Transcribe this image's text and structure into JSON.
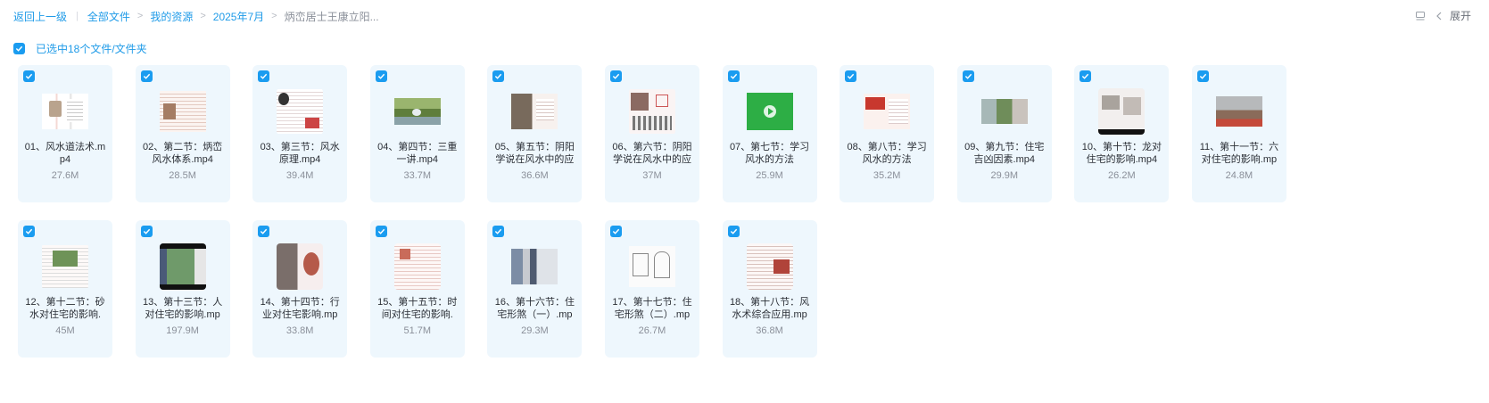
{
  "breadcrumb": {
    "back": "返回上一级",
    "items": [
      "全部文件",
      "我的资源",
      "2025年7月"
    ],
    "current": "炳峦居士王康立阳..."
  },
  "toolbar": {
    "expand_label": "展开"
  },
  "selection": {
    "label": "已选中18个文件/文件夹"
  },
  "files": [
    {
      "name": "01、风水道法术.mp4",
      "size": "27.6M",
      "thumb": "doc"
    },
    {
      "name": "02、第二节：炳峦风水体系.mp4",
      "size": "28.5M",
      "thumb": "doc2"
    },
    {
      "name": "03、第三节：风水原理.mp4",
      "size": "39.4M",
      "thumb": "doc3"
    },
    {
      "name": "04、第四节：三重一讲.mp4",
      "size": "33.7M",
      "thumb": "photo"
    },
    {
      "name": "05、第五节：阴阳学说在风水中的应",
      "size": "36.6M",
      "thumb": "photo2"
    },
    {
      "name": "06、第六节：阴阳学说在风水中的应",
      "size": "37M",
      "thumb": "doc4"
    },
    {
      "name": "07、第七节：学习风水的方法",
      "size": "25.9M",
      "thumb": "green"
    },
    {
      "name": "08、第八节：学习风水的方法",
      "size": "35.2M",
      "thumb": "red"
    },
    {
      "name": "09、第九节：住宅吉凶因素.mp4",
      "size": "29.9M",
      "thumb": "photo3"
    },
    {
      "name": "10、第十节：龙对住宅的影响.mp4",
      "size": "26.2M",
      "thumb": "doc5"
    },
    {
      "name": "11、第十一节：六对住宅的影响.mp",
      "size": "24.8M",
      "thumb": "photo4"
    },
    {
      "name": "12、第十二节：砂水对住宅的影响.",
      "size": "45M",
      "thumb": "doc6"
    },
    {
      "name": "13、第十三节：人对住宅的影响.mp",
      "size": "197.9M",
      "thumb": "photo5"
    },
    {
      "name": "14、第十四节：行业对住宅影响.mp",
      "size": "33.8M",
      "thumb": "doc7"
    },
    {
      "name": "15、第十五节：时间对住宅的影响.",
      "size": "51.7M",
      "thumb": "doc8"
    },
    {
      "name": "16、第十六节：住宅形煞（一）.mp",
      "size": "29.3M",
      "thumb": "photo6"
    },
    {
      "name": "17、第十七节：住宅形煞（二）.mp",
      "size": "26.7M",
      "thumb": "doc9"
    },
    {
      "name": "18、第十八节：风水术综合应用.mp",
      "size": "36.8M",
      "thumb": "doc10"
    }
  ],
  "colors": {
    "accent": "#1a9cf0",
    "card_bg": "#eef7fd",
    "muted": "#8a8f99"
  }
}
